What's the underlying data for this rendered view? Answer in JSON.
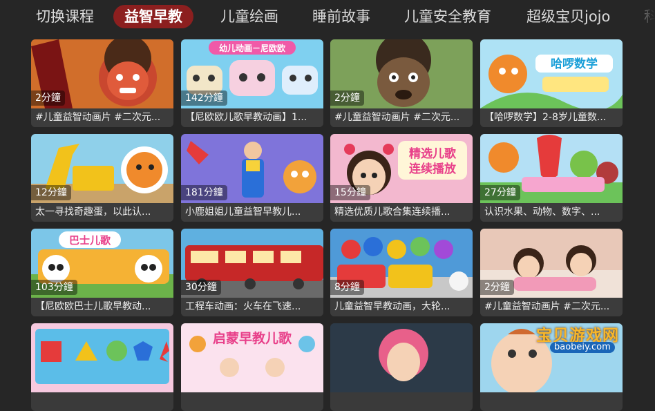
{
  "tabs": [
    {
      "label": "切换课程",
      "active": false
    },
    {
      "label": "益智早教",
      "active": true
    },
    {
      "label": "儿童绘画",
      "active": false
    },
    {
      "label": "睡前故事",
      "active": false
    },
    {
      "label": "儿童安全教育",
      "active": false
    },
    {
      "label": "超级宝贝jojo",
      "active": false
    },
    {
      "label": "科",
      "active": false
    }
  ],
  "videos": [
    {
      "duration": "2分鐘",
      "title": "#儿童益智动画片 #二次元...",
      "thumb": "angry-boy-cartoon"
    },
    {
      "duration": "142分鐘",
      "title": "【尼欧欧儿歌早教动画】1...",
      "thumb": "cartoon-cars",
      "overlay_text": "幼儿动画－尼欧欧"
    },
    {
      "duration": "2分鐘",
      "title": "#儿童益智动画片 #二次元...",
      "thumb": "muddy-boy-cartoon"
    },
    {
      "duration": "",
      "title": "【哈啰数学】2-8岁儿童数...",
      "thumb": "math-panda",
      "overlay_text": "哈啰数学"
    },
    {
      "duration": "12分鐘",
      "title": "太一寻找奇趣蛋，以此认...",
      "thumb": "excavator-robot"
    },
    {
      "duration": "181分鐘",
      "title": "小鹿姐姐儿童益智早教儿...",
      "thumb": "teacher-dancing"
    },
    {
      "duration": "15分鐘",
      "title": "精选优质儿歌合集连续播...",
      "thumb": "girl-songs",
      "overlay_text": "精选儿歌 连续播放"
    },
    {
      "duration": "27分鐘",
      "title": "认识水果、动物、数字、...",
      "thumb": "fruits"
    },
    {
      "duration": "103分鐘",
      "title": "【尼欧欧巴士儿歌早教动...",
      "thumb": "bus-panda",
      "overlay_text": "巴士儿歌"
    },
    {
      "duration": "30分鐘",
      "title": "工程车动画：火车在飞速...",
      "thumb": "red-train"
    },
    {
      "duration": "8分鐘",
      "title": "儿童益智早教动画，大轮...",
      "thumb": "motorbikes"
    },
    {
      "duration": "2分鐘",
      "title": "#儿童益智动画片 #二次元...",
      "thumb": "kids-sleeping"
    },
    {
      "duration": "",
      "title": "",
      "thumb": "shape-sorter"
    },
    {
      "duration": "",
      "title": "",
      "thumb": "enlightenment-songs",
      "overlay_text": "启蒙早教儿歌"
    },
    {
      "duration": "",
      "title": "",
      "thumb": "pink-hair-girl"
    },
    {
      "duration": "",
      "title": "",
      "thumb": "crying-baby"
    }
  ],
  "watermark": {
    "text": "宝贝游戏网",
    "url": "baobeiy.com"
  },
  "colors": {
    "background": "#262626",
    "active_tab": "#8c1f1f",
    "caption_bg": "#3c3c3c"
  }
}
